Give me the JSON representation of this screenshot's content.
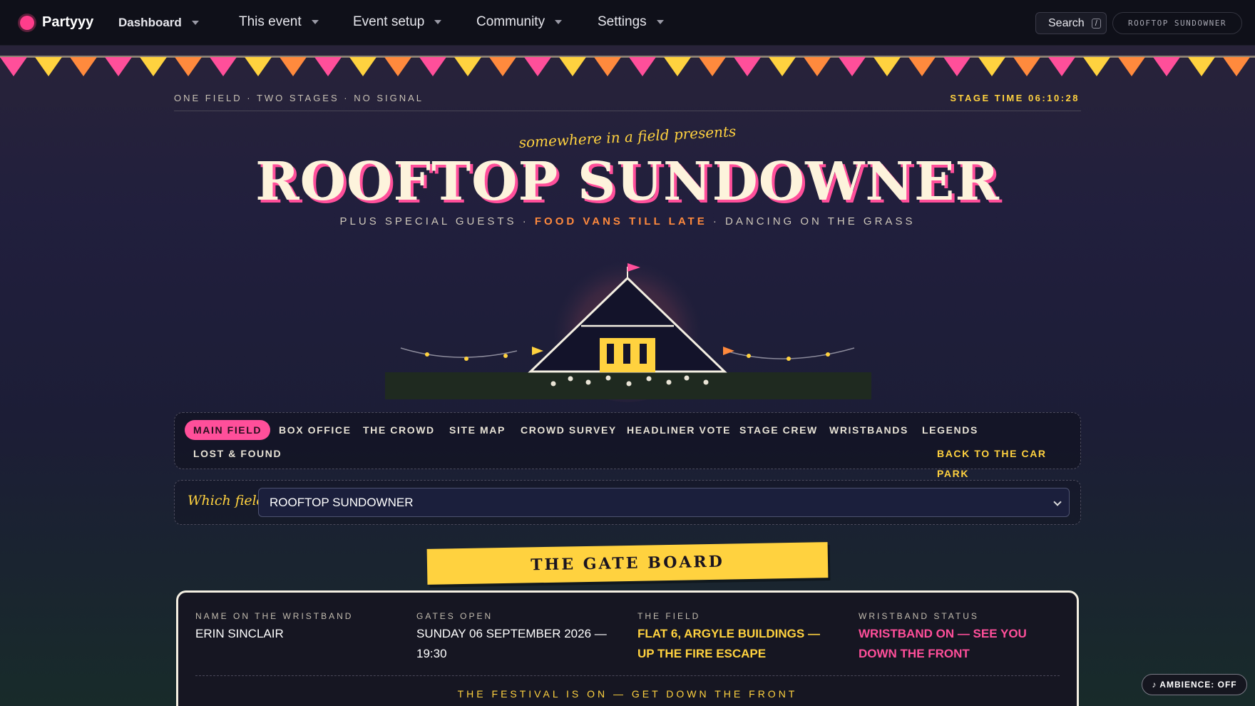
{
  "nav": {
    "brand": "Partyyy",
    "items": [
      {
        "label": "Dashboard"
      },
      {
        "label": "This event"
      },
      {
        "label": "Event setup"
      },
      {
        "label": "Community"
      },
      {
        "label": "Settings"
      }
    ],
    "search_label": "Search",
    "search_shortcut": "/",
    "event_pill": "ROOFTOP SUNDOWNER"
  },
  "header": {
    "tagline_left": "ONE FIELD · TWO STAGES · NO SIGNAL",
    "stage_time": "STAGE TIME 06:10:28",
    "presents": "somewhere in a field presents",
    "title": "ROOFTOP SUNDOWNER",
    "sub_1": "PLUS SPECIAL GUESTS · ",
    "sub_highlight": "FOOD VANS TILL LATE",
    "sub_2": " · DANCING ON THE GRASS"
  },
  "tabs": [
    {
      "label": "MAIN FIELD",
      "active": true
    },
    {
      "label": "BOX OFFICE"
    },
    {
      "label": "THE CROWD"
    },
    {
      "label": "SITE MAP"
    },
    {
      "label": "CROWD SURVEY"
    },
    {
      "label": "HEADLINER VOTE"
    },
    {
      "label": "STAGE CREW"
    },
    {
      "label": "WRISTBANDS"
    },
    {
      "label": "LEGENDS"
    },
    {
      "label": "LOST & FOUND"
    }
  ],
  "back_link": "BACK TO THE CAR PARK",
  "field_picker": {
    "label": "Which field?",
    "selected": "ROOFTOP SUNDOWNER"
  },
  "gate_board": {
    "title": "THE GATE BOARD",
    "cells": [
      {
        "label": "NAME ON THE WRISTBAND",
        "value": "ERIN SINCLAIR"
      },
      {
        "label": "GATES OPEN",
        "value": "SUNDAY 06 SEPTEMBER 2026 — 19:30"
      },
      {
        "label": "THE FIELD",
        "value": "FLAT 6, ARGYLE BUILDINGS — UP THE FIRE ESCAPE"
      },
      {
        "label": "WRISTBAND STATUS",
        "value": "WRISTBAND ON — SEE YOU DOWN THE FRONT"
      }
    ],
    "footer": "THE FESTIVAL IS ON — GET DOWN THE FRONT"
  },
  "ambience": "♪ AMBIENCE: OFF",
  "colors": {
    "accent_pink": "#ff4f9a",
    "accent_yellow": "#ffd23f",
    "accent_orange": "#ff8a3d"
  }
}
